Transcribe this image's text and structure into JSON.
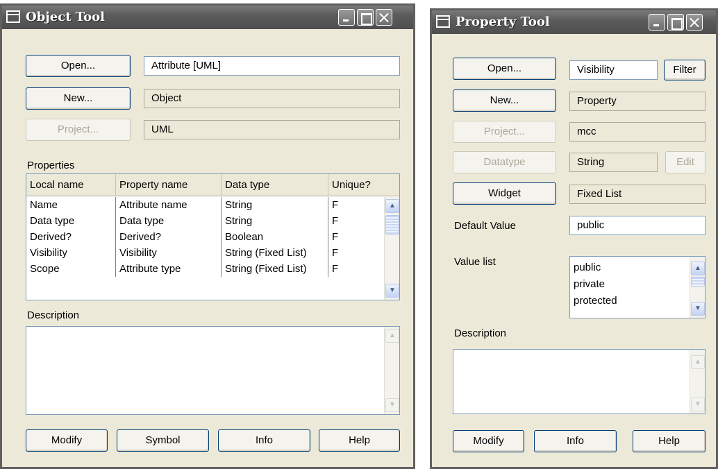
{
  "object_tool": {
    "title": "Object Tool",
    "open_label": "Open...",
    "new_label": "New...",
    "project_label": "Project...",
    "open_value": "Attribute [UML]",
    "new_value": "Object",
    "project_value": "UML",
    "properties_label": "Properties",
    "columns": [
      "Local name",
      "Property name",
      "Data type",
      "Unique?"
    ],
    "rows": [
      [
        "Name",
        "Attribute name",
        "String",
        "F"
      ],
      [
        "Data type",
        "Data type",
        "String",
        "F"
      ],
      [
        "Derived?",
        "Derived?",
        "Boolean",
        "F"
      ],
      [
        "Visibility",
        "Visibility",
        "String (Fixed List)",
        "F"
      ],
      [
        "Scope",
        "Attribute type",
        "String (Fixed List)",
        "F"
      ]
    ],
    "description_label": "Description",
    "modify_label": "Modify",
    "symbol_label": "Symbol",
    "info_label": "Info",
    "help_label": "Help"
  },
  "property_tool": {
    "title": "Property Tool",
    "open_label": "Open...",
    "new_label": "New...",
    "project_label": "Project...",
    "datatype_label": "Datatype",
    "widget_label": "Widget",
    "open_value": "Visibility",
    "filter_label": "Filter",
    "new_value": "Property",
    "project_value": "mcc",
    "datatype_value": "String",
    "edit_label": "Edit",
    "widget_value": "Fixed List",
    "default_value_label": "Default Value",
    "default_value": "public",
    "value_list_label": "Value list",
    "value_list": [
      "public",
      "private",
      "protected"
    ],
    "description_label": "Description",
    "modify_label": "Modify",
    "info_label": "Info",
    "help_label": "Help"
  }
}
